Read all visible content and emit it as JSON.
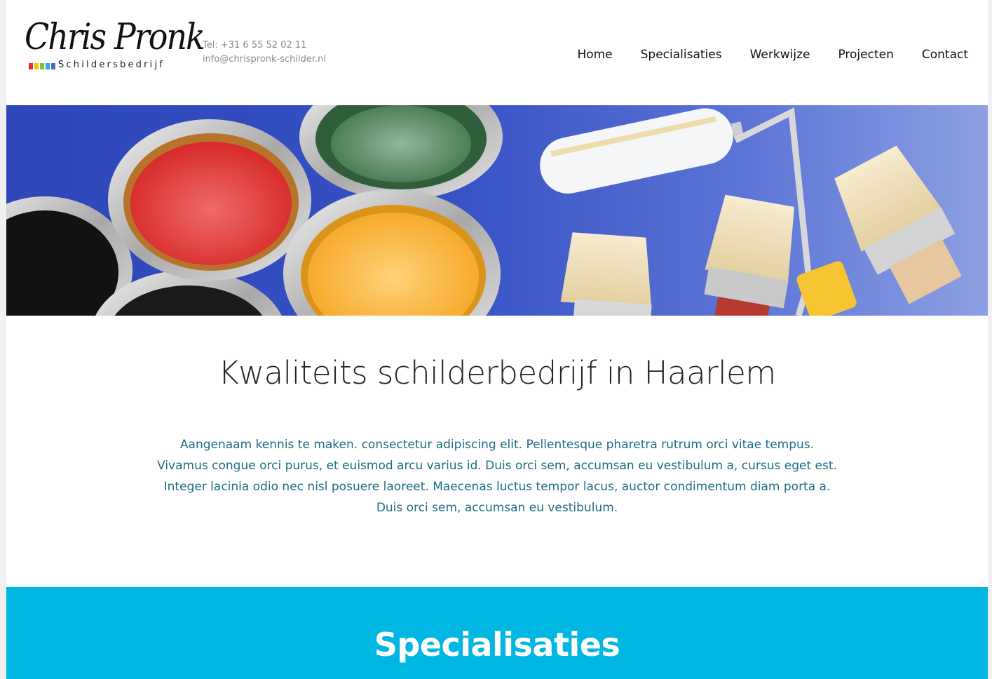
{
  "brand": {
    "logo_script": "Chris Pronk",
    "logo_sub": "Schildersbedrijf",
    "logo_square_colors": [
      "#e8312a",
      "#f5c400",
      "#7fbf3a",
      "#3aa3dd",
      "#3f6fc4"
    ]
  },
  "contact": {
    "phone": "Tel: +31 6 55 52 02 11",
    "email": "info@chrispronk-schilder.nl"
  },
  "nav": {
    "items": [
      {
        "label": "Home"
      },
      {
        "label": "Specialisaties"
      },
      {
        "label": "Werkwijze"
      },
      {
        "label": "Projecten"
      },
      {
        "label": "Contact"
      }
    ]
  },
  "hero": {
    "image": "paint-cans-and-brushes-photo"
  },
  "intro": {
    "title": "Kwaliteits schilderbedrijf in Haarlem",
    "text": "Aangenaam kennis te maken. consectetur adipiscing elit. Pellentesque pharetra rutrum orci vitae tempus. Vivamus congue orci purus, et euismod arcu varius id. Duis orci sem, accumsan eu vestibulum a, cursus eget est. Integer lacinia odio nec nisl posuere laoreet. Maecenas luctus tempor lacus, auctor condimentum diam porta a. Duis orci sem, accumsan eu vestibulum."
  },
  "specialisaties": {
    "title": "Specialisaties"
  },
  "colors": {
    "accent": "#00b6e2",
    "body_text": "#1e6d84"
  }
}
